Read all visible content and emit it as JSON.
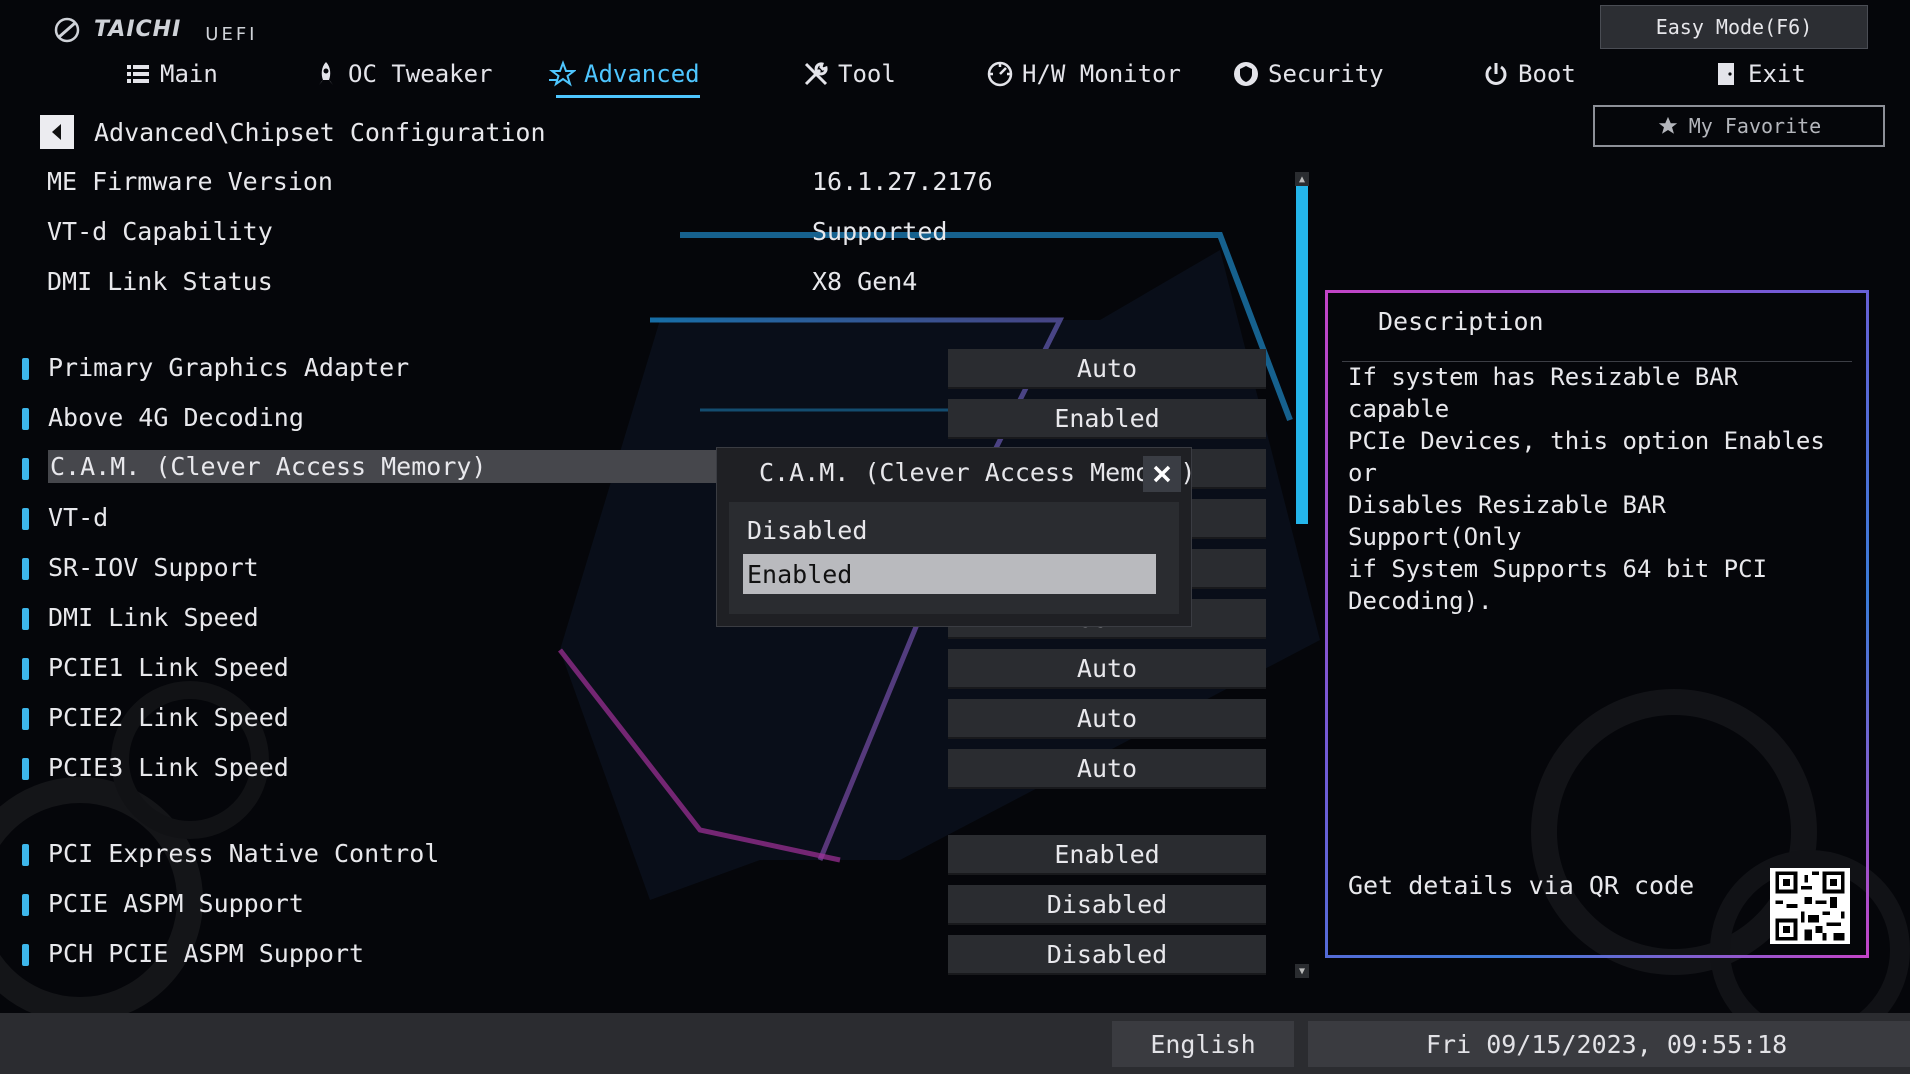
{
  "brand": {
    "name": "TAICHI",
    "suffix": "UEFI"
  },
  "header": {
    "easy_mode": "Easy Mode(F6)",
    "favorite": "My Favorite",
    "tabs": [
      {
        "label": "Main",
        "icon": "list-icon",
        "active": false
      },
      {
        "label": "OC Tweaker",
        "icon": "rocket-icon",
        "active": false
      },
      {
        "label": "Advanced",
        "icon": "star-icon",
        "active": true
      },
      {
        "label": "Tool",
        "icon": "tools-icon",
        "active": false
      },
      {
        "label": "H/W Monitor",
        "icon": "gauge-icon",
        "active": false
      },
      {
        "label": "Security",
        "icon": "shield-icon",
        "active": false
      },
      {
        "label": "Boot",
        "icon": "power-icon",
        "active": false
      },
      {
        "label": "Exit",
        "icon": "exit-door-icon",
        "active": false
      }
    ]
  },
  "breadcrumb": "Advanced\\Chipset Configuration",
  "info": [
    {
      "label": "ME Firmware Version",
      "value": "16.1.27.2176"
    },
    {
      "label": "VT-d Capability",
      "value": "Supported"
    },
    {
      "label": "DMI Link Status",
      "value": "X8  Gen4"
    }
  ],
  "settings": [
    {
      "label": "Primary Graphics Adapter",
      "value": "Auto"
    },
    {
      "label": "Above 4G Decoding",
      "value": "Enabled"
    },
    {
      "label": "C.A.M. (Clever Access Memory)",
      "value": "",
      "selected": true
    },
    {
      "label": "VT-d",
      "value": ""
    },
    {
      "label": "SR-IOV Support",
      "value": ""
    },
    {
      "label": "DMI Link Speed",
      "value": "Gen4"
    },
    {
      "label": "PCIE1 Link Speed",
      "value": "Auto"
    },
    {
      "label": "PCIE2 Link Speed",
      "value": "Auto"
    },
    {
      "label": "PCIE3 Link Speed",
      "value": "Auto"
    },
    {
      "label": "PCI Express Native Control",
      "value": "Enabled"
    },
    {
      "label": "PCIE ASPM Support",
      "value": "Disabled"
    },
    {
      "label": "PCH PCIE ASPM Support",
      "value": "Disabled"
    }
  ],
  "popup": {
    "title": "C.A.M. (Clever Access Memory)",
    "options": [
      "Disabled",
      "Enabled"
    ],
    "selected": "Enabled"
  },
  "description": {
    "heading": "Description",
    "text": "If system has Resizable BAR capable\nPCIe Devices, this option Enables or\nDisables Resizable BAR Support(Only\nif System Supports 64 bit PCI\nDecoding).",
    "qr_text": "Get details via QR code"
  },
  "footer": {
    "language": "English",
    "datetime": "Fri 09/15/2023, 09:55:18"
  },
  "colors": {
    "accent": "#4ec6ff",
    "scroll_thumb": "#24b5ea",
    "panel_border": "#c344c7"
  }
}
